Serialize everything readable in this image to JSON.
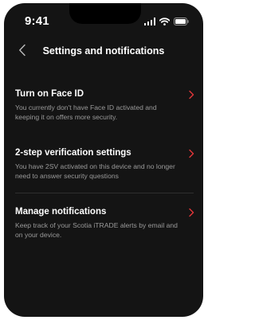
{
  "status_bar": {
    "time": "9:41"
  },
  "header": {
    "title": "Settings and notifications",
    "back_icon": "chevron-left-icon"
  },
  "settings": [
    {
      "title": "Turn on Face ID",
      "description": "You currently don't have Face ID activated and keeping it on offers more security.",
      "icon": "chevron-right-icon"
    },
    {
      "title": "2-step verification settings",
      "description": "You have 2SV activated on this device and no longer need to answer security questions",
      "icon": "chevron-right-icon"
    },
    {
      "title": "Manage notifications",
      "description": "Keep track of your Scotia iTRADE alerts by email and on your device.",
      "icon": "chevron-right-icon"
    }
  ],
  "colors": {
    "background": "#141414",
    "accent": "#e4363a",
    "secondary_text": "#9a9a9a"
  }
}
